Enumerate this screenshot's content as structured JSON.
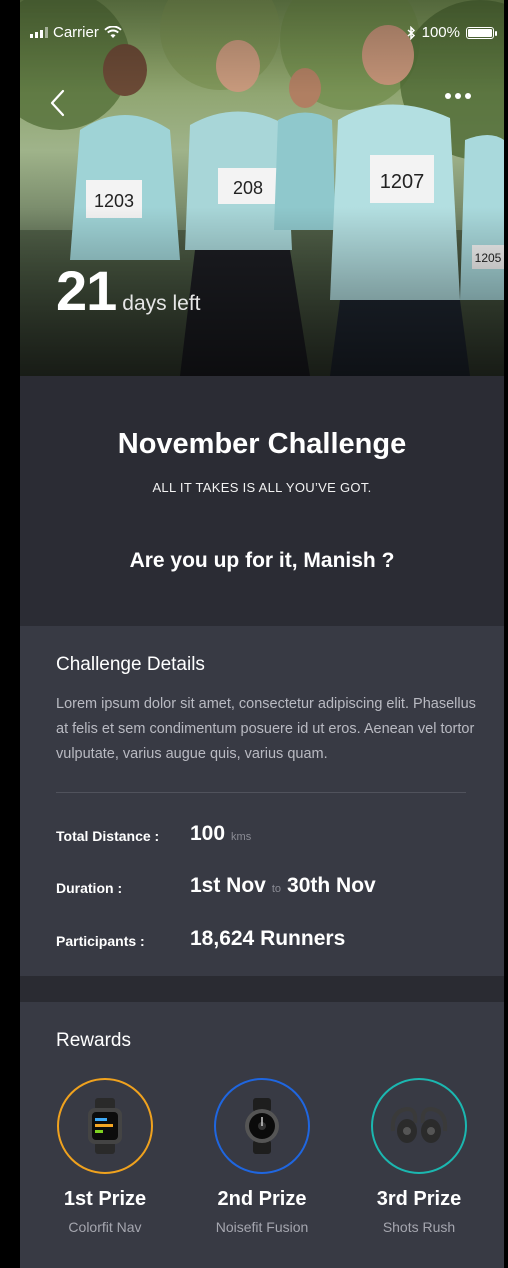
{
  "status": {
    "carrier": "Carrier",
    "battery": "100%"
  },
  "hero": {
    "days_left_number": "21",
    "days_left_label": "days left",
    "bibs": [
      "1203",
      "208",
      "1207",
      "1205"
    ]
  },
  "intro": {
    "title": "November Challenge",
    "tagline": "ALL IT TAKES IS ALL YOU’VE GOT.",
    "question": "Are you up for it, Manish ?"
  },
  "details": {
    "heading": "Challenge Details",
    "description": "Lorem ipsum dolor sit amet, consectetur adipiscing elit. Phasellus at felis et sem condimentum posuere id ut eros. Aenean vel tortor vulputate, varius augue quis, varius quam.",
    "distance_label": "Total Distance :",
    "distance_value": "100",
    "distance_unit": "kms",
    "duration_label": "Duration :",
    "duration_start": "1st Nov",
    "duration_sep": "to",
    "duration_end": "30th Nov",
    "participants_label": "Participants :",
    "participants_value": "18,624 Runners"
  },
  "rewards": {
    "heading": "Rewards",
    "prizes": [
      {
        "rank": "1st Prize",
        "name": "Colorfit Nav",
        "color": "#f0a21e",
        "icon": "smartwatch-icon"
      },
      {
        "rank": "2nd Prize",
        "name": "Noisefit Fusion",
        "color": "#1f66e0",
        "icon": "round-watch-icon"
      },
      {
        "rank": "3rd Prize",
        "name": "Shots Rush",
        "color": "#1bb7b0",
        "icon": "earbuds-icon"
      }
    ]
  },
  "colors": {
    "background": "#2f3039",
    "card": "#383a44",
    "intro": "#2b2c34"
  }
}
